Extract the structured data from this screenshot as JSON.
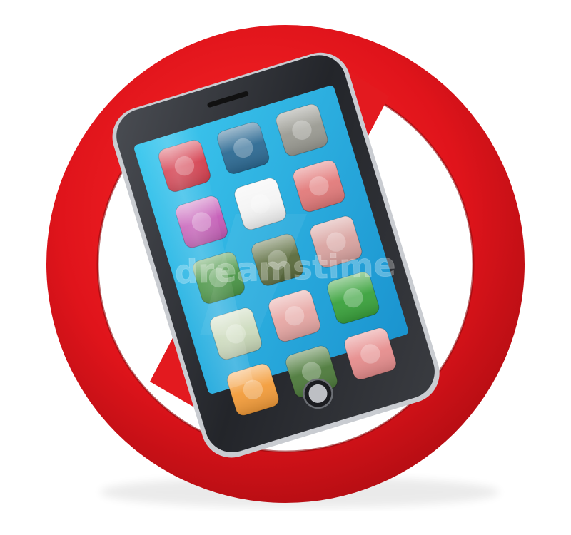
{
  "colors": {
    "background": "#ffffff",
    "sign_red": "#e0141b",
    "sign_red_dark": "#a50b10",
    "phone_body": "#2b2d31",
    "phone_frame": "#c9ccd1",
    "screen_top": "#3ec9ef",
    "screen_bottom": "#1da2d8"
  },
  "sign": {
    "icon": "prohibition-sign"
  },
  "phone": {
    "icon": "smartphone"
  },
  "apps": [
    {
      "icon": "red-blood-cells-app-icon",
      "color": "#d33a4a"
    },
    {
      "icon": "stock-chart-app-icon",
      "color": "#2d6a93"
    },
    {
      "icon": "pebbles-app-icon",
      "color": "#9a9a92"
    },
    {
      "icon": "mail-envelope-app-icon",
      "color": "#c45ab6"
    },
    {
      "icon": "color-wheel-app-icon",
      "color": "#f4f4f4"
    },
    {
      "icon": "calendar-app-icon",
      "color": "#e27a7a"
    },
    {
      "icon": "leaf-app-icon",
      "color": "#3f8f3a"
    },
    {
      "icon": "wall-street-sign-app-icon",
      "color": "#5a6b3c"
    },
    {
      "icon": "maze-app-icon",
      "color": "#d9a3a0"
    },
    {
      "icon": "race-cars-app-icon",
      "color": "#c9d8b8"
    },
    {
      "icon": "gift-box-app-icon",
      "color": "#e7a7a4"
    },
    {
      "icon": "green-arrows-app-icon",
      "color": "#3aa23c"
    },
    {
      "icon": "house-app-icon",
      "color": "#f39c3a"
    },
    {
      "icon": "puzzle-app-icon",
      "color": "#4d7a3b"
    },
    {
      "icon": "flowchart-app-icon",
      "color": "#e68d8d"
    }
  ],
  "watermark": "dreamstime"
}
